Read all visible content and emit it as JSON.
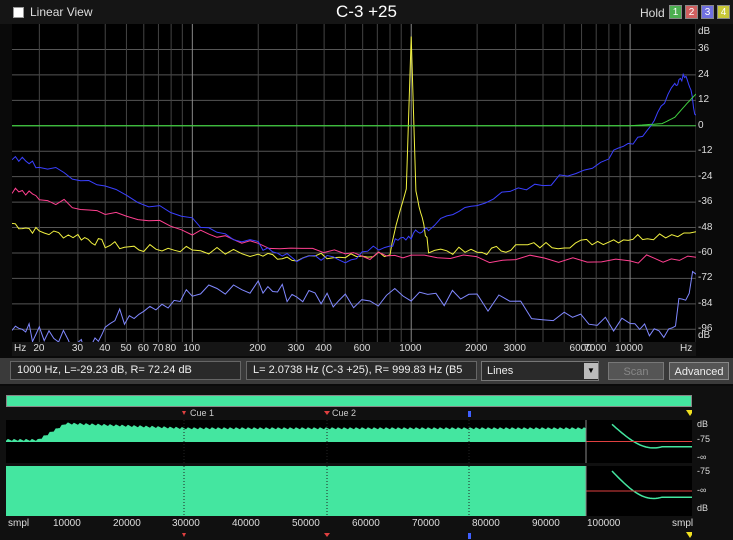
{
  "topbar": {
    "linear_view_label": "Linear View",
    "title": "C-3 +25",
    "hold_label": "Hold",
    "hold_buttons": [
      {
        "label": "1",
        "color": "#4caf50"
      },
      {
        "label": "2",
        "color": "#d06060"
      },
      {
        "label": "3",
        "color": "#7070e0"
      },
      {
        "label": "4",
        "color": "#c8c838"
      }
    ]
  },
  "spectrum": {
    "db_unit": "dB",
    "db_labels": [
      "36",
      "24",
      "12",
      "0",
      "-12",
      "-24",
      "-36",
      "-48",
      "-60",
      "-72",
      "-84",
      "-96",
      "dB"
    ],
    "x_labels": [
      "Hz",
      "20",
      "30",
      "40",
      "50",
      "60",
      "70",
      "80",
      "100",
      "200",
      "300",
      "400",
      "600",
      "1000",
      "2000",
      "3000",
      "6000",
      "7000",
      "10000",
      "Hz"
    ]
  },
  "controls": {
    "cursor_readout": "1000 Hz, L=-29.23 dB, R= 72.24 dB",
    "marker_readout": "L= 2.0738 Hz (C-3 +25), R= 999.83 Hz (B5",
    "display_mode": "Lines",
    "scan_label": "Scan",
    "advanced_label": "Advanced"
  },
  "waveform": {
    "cues": [
      {
        "label": "Cue 1"
      },
      {
        "label": "Cue 2"
      }
    ],
    "db_labels_top": [
      "dB",
      "-75",
      "-∞"
    ],
    "db_labels_bottom": [
      "-75",
      "-∞",
      "dB"
    ],
    "time_labels": [
      "smpl",
      "10000",
      "20000",
      "30000",
      "40000",
      "50000",
      "60000",
      "70000",
      "80000",
      "90000",
      "100000",
      "smpl"
    ]
  },
  "chart_data": {
    "type": "line",
    "x_scale": "log",
    "xlim": [
      15,
      20000
    ],
    "ylim": [
      -102,
      48
    ],
    "ylabel": "dB",
    "grid": true,
    "series": [
      {
        "color": "#f0f040",
        "x": [
          15,
          20,
          30,
          40,
          60,
          100,
          200,
          300,
          500,
          800,
          950,
          1000,
          1050,
          1200,
          2000,
          3000,
          5000,
          8000,
          12000,
          20000
        ],
        "y": [
          -46,
          -50,
          -52,
          -56,
          -58,
          -58,
          -61,
          -62,
          -62,
          -60,
          -30,
          44,
          -30,
          -58,
          -60,
          -57,
          -56,
          -54,
          -52,
          -50
        ]
      },
      {
        "color": "#ff4090",
        "x": [
          15,
          20,
          40,
          100,
          200,
          500,
          1000,
          3000,
          10000,
          20000
        ],
        "y": [
          -30,
          -34,
          -40,
          -50,
          -57,
          -61,
          -62,
          -63,
          -63,
          -62
        ]
      },
      {
        "color": "#3a40ff",
        "x": [
          15,
          20,
          40,
          100,
          200,
          300,
          500,
          800,
          1000,
          1200,
          2000,
          4000,
          8000,
          12000,
          16000,
          18000,
          20000
        ],
        "y": [
          -15,
          -19,
          -28,
          -45,
          -56,
          -63,
          -63,
          -56,
          -52,
          -48,
          -36,
          -28,
          -15,
          -2,
          20,
          25,
          5
        ]
      },
      {
        "color": "#8088ff",
        "x": [
          15,
          20,
          30,
          40,
          60,
          100,
          200,
          300,
          500,
          1000,
          2000,
          5000,
          10000,
          15000,
          20000
        ],
        "y": [
          -100,
          -96,
          -104,
          -95,
          -84,
          -80,
          -76,
          -80,
          -82,
          -78,
          -82,
          -92,
          -94,
          -96,
          -70
        ]
      },
      {
        "color": "#40d040",
        "x": [
          15,
          100,
          1000,
          10000,
          14000,
          16000,
          18000,
          20000
        ],
        "y": [
          0,
          0,
          0,
          0,
          1,
          4,
          10,
          15
        ]
      }
    ]
  }
}
